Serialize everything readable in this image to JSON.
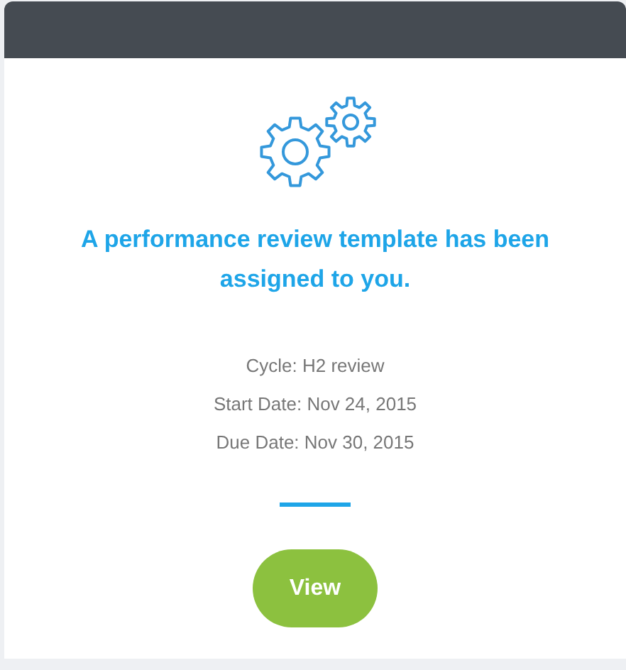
{
  "message": {
    "title": "A performance review template has been assigned to you."
  },
  "details": [
    "Cycle: H2 review",
    "Start Date: Nov 24, 2015",
    "Due Date: Nov 30, 2015"
  ],
  "button": {
    "label": "View"
  }
}
